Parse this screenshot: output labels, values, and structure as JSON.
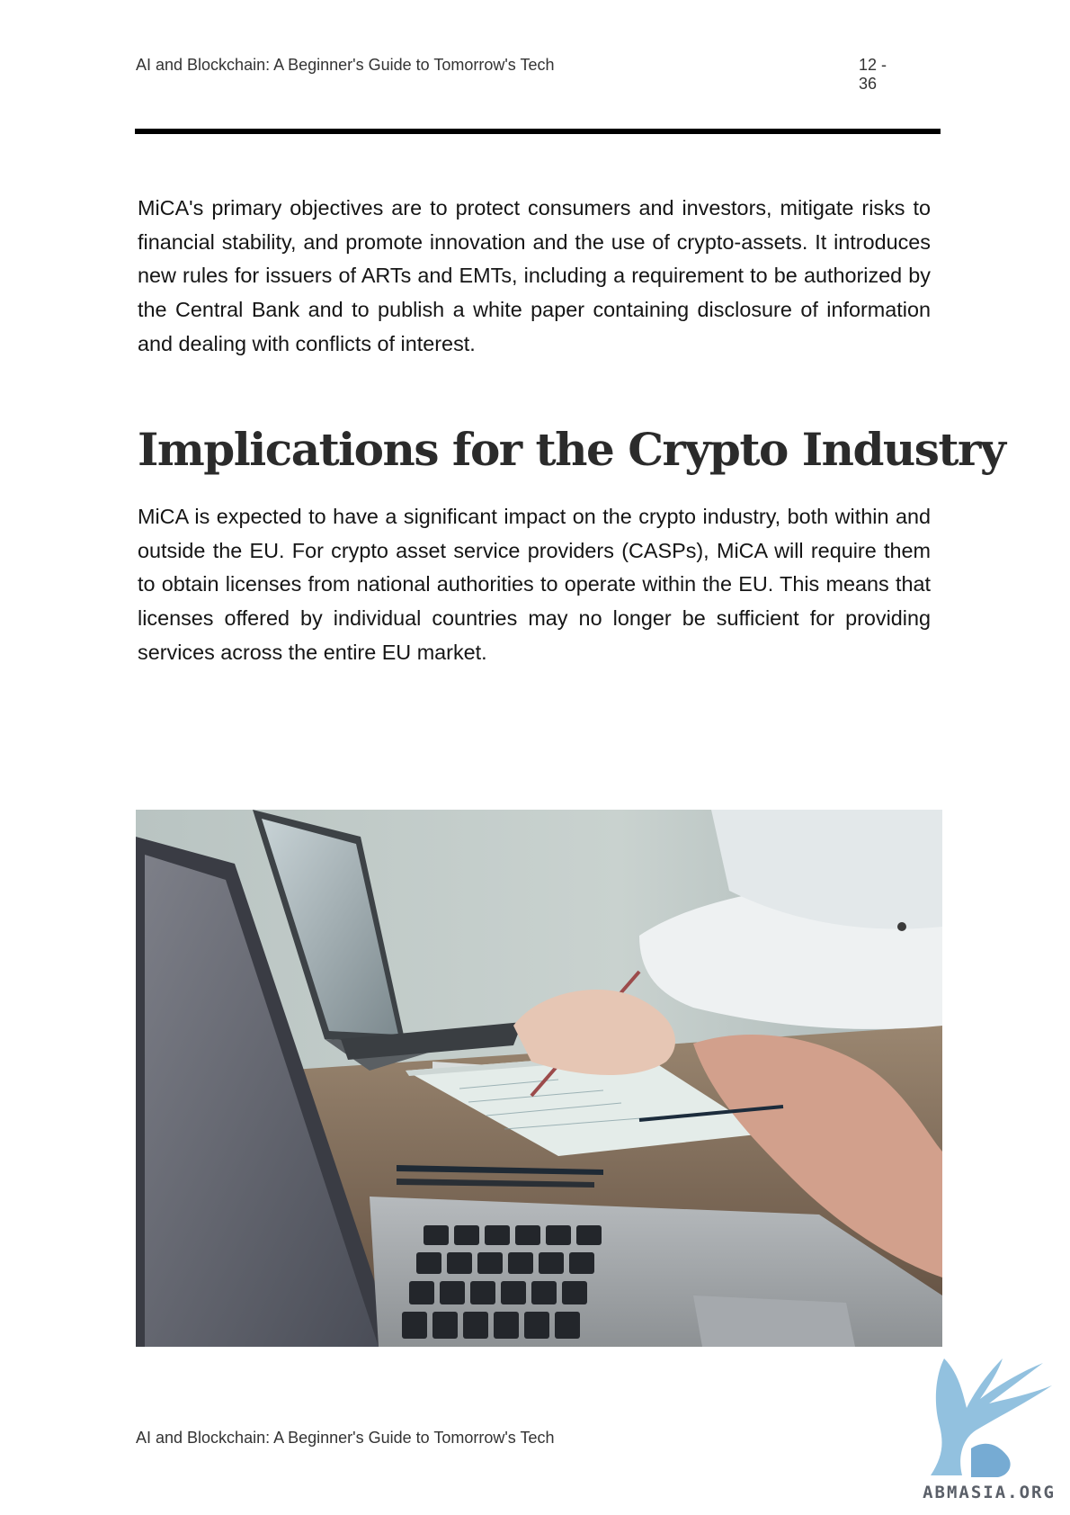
{
  "header": {
    "title": "AI and Blockchain: A Beginner's Guide to Tomorrow's Tech",
    "page_number": "12 - 36"
  },
  "content": {
    "paragraph_1": "MiCA's primary objectives are to protect consumers and investors, mitigate risks to financial stability, and promote innovation and the use of crypto-assets. It introduces new rules for issuers of ARTs and EMTs, including a requirement to be authorized by the Central Bank and to publish a white paper containing disclosure of information and dealing with conflicts of interest.",
    "heading": "Implications for the Crypto Industry",
    "paragraph_2": "MiCA is expected to have a significant impact on the crypto industry, both within and outside the EU. For crypto asset service providers (CASPs), MiCA will require them to obtain licenses from national authorities to operate within the EU. This means that licenses offered by individual countries may no longer be sufficient for providing services across the entire EU market."
  },
  "footer": {
    "title": "AI and Blockchain: A Beginner's Guide to Tomorrow's Tech"
  },
  "watermark": {
    "text": "ABMASIA.ORG"
  }
}
